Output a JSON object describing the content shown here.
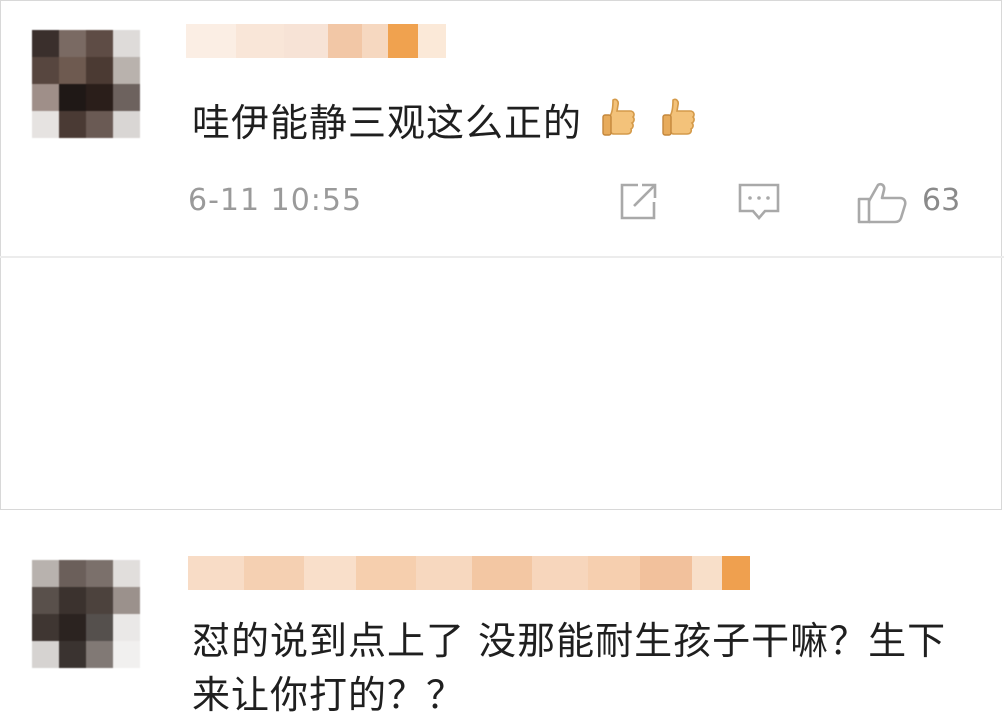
{
  "comments": [
    {
      "text": "哇伊能静三观这么正的",
      "emoji": [
        "thumbs-up",
        "thumbs-up"
      ],
      "timestamp": "6-11 10:55",
      "likes": "63"
    },
    {
      "text": "怼的说到点上了 没那能耐生孩子干嘛？生下来让你打的？？"
    }
  ],
  "colors": {
    "text": "#1f1f1f",
    "meta": "#9a9a9a",
    "icon": "#a9a9a9",
    "divider": "#ececec"
  }
}
